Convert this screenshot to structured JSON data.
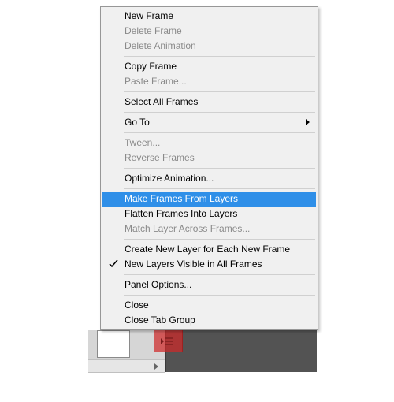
{
  "menu": {
    "items": [
      {
        "label": "New Frame",
        "enabled": true
      },
      {
        "label": "Delete Frame",
        "enabled": false
      },
      {
        "label": "Delete Animation",
        "enabled": false
      },
      {
        "sep": true
      },
      {
        "label": "Copy Frame",
        "enabled": true
      },
      {
        "label": "Paste Frame...",
        "enabled": false
      },
      {
        "sep": true
      },
      {
        "label": "Select All Frames",
        "enabled": true
      },
      {
        "sep": true
      },
      {
        "label": "Go To",
        "enabled": true,
        "submenu": true
      },
      {
        "sep": true
      },
      {
        "label": "Tween...",
        "enabled": false
      },
      {
        "label": "Reverse Frames",
        "enabled": false
      },
      {
        "sep": true
      },
      {
        "label": "Optimize Animation...",
        "enabled": true
      },
      {
        "sep": true
      },
      {
        "label": "Make Frames From Layers",
        "enabled": true,
        "highlight": true
      },
      {
        "label": "Flatten Frames Into Layers",
        "enabled": true
      },
      {
        "label": "Match Layer Across Frames...",
        "enabled": false
      },
      {
        "sep": true
      },
      {
        "label": "Create New Layer for Each New Frame",
        "enabled": true
      },
      {
        "label": "New Layers Visible in All Frames",
        "enabled": true,
        "checked": true
      },
      {
        "sep": true
      },
      {
        "label": "Panel Options...",
        "enabled": true
      },
      {
        "sep": true
      },
      {
        "label": "Close",
        "enabled": true
      },
      {
        "label": "Close Tab Group",
        "enabled": true
      }
    ]
  },
  "panel": {
    "menu_button": "panel-menu"
  }
}
